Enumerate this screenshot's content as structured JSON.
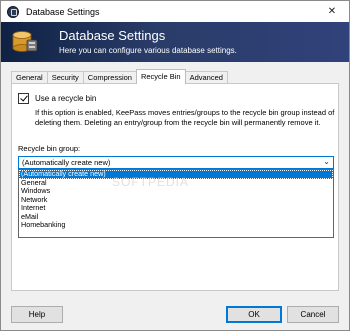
{
  "window": {
    "title": "Database Settings",
    "controls": {
      "close": "✕"
    }
  },
  "banner": {
    "title": "Database Settings",
    "subtitle": "Here you can configure various database settings."
  },
  "tabs": [
    {
      "label": "General",
      "active": false
    },
    {
      "label": "Security",
      "active": false
    },
    {
      "label": "Compression",
      "active": false
    },
    {
      "label": "Recycle Bin",
      "active": true
    },
    {
      "label": "Advanced",
      "active": false
    }
  ],
  "recycle_bin": {
    "use_recycle_bin_label": "Use a recycle bin",
    "use_recycle_bin_checked": true,
    "description": "If this option is enabled, KeePass moves entries/groups to the recycle bin group instead of deleting them. Deleting an entry/group from the recycle bin will permanently remove it.",
    "group_label": "Recycle bin group:",
    "group_value": "(Automatically create new)",
    "group_options": [
      "(Automatically create new)",
      "General",
      "Windows",
      "Network",
      "Internet",
      "eMail",
      "Homebanking"
    ],
    "selected_index": 0
  },
  "watermark": "SOFTPEDIA",
  "buttons": {
    "help": "Help",
    "ok": "OK",
    "cancel": "Cancel"
  },
  "colors": {
    "accent": "#0078d7",
    "banner_dark": "#0f2244",
    "banner_light": "#30427a"
  }
}
